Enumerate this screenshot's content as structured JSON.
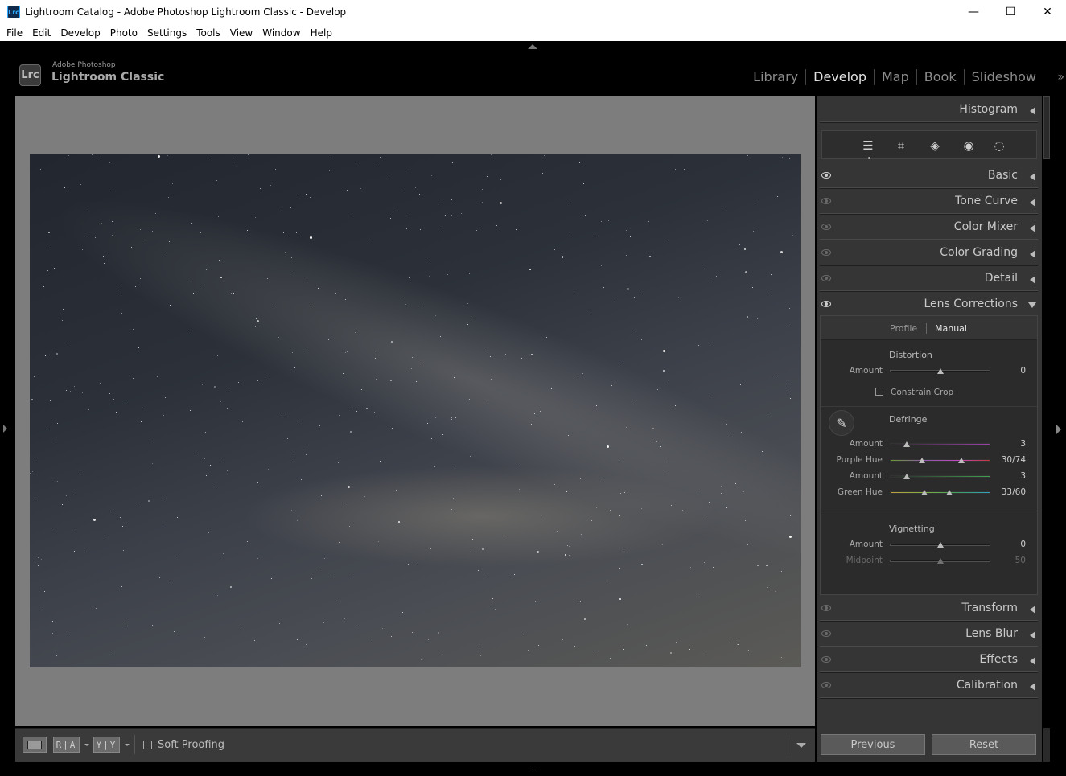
{
  "window": {
    "app_icon": "Lrc",
    "title": "Lightroom Catalog - Adobe Photoshop Lightroom Classic - Develop",
    "controls": {
      "minimize": "—",
      "maximize": "☐",
      "close": "✕"
    }
  },
  "menubar": {
    "items": [
      "File",
      "Edit",
      "Develop",
      "Photo",
      "Settings",
      "Tools",
      "View",
      "Window",
      "Help"
    ]
  },
  "brand": {
    "logo": "Lrc",
    "small": "Adobe Photoshop",
    "big": "Lightroom Classic"
  },
  "modules": {
    "items": [
      "Library",
      "Develop",
      "Map",
      "Book",
      "Slideshow"
    ],
    "active": "Develop",
    "more": "»"
  },
  "toolbar": {
    "before_after_left": "R|A",
    "before_after_right": "Y|Y",
    "soft_proofing_label": "Soft Proofing",
    "soft_proofing_checked": false
  },
  "right_panel": {
    "histogram": "Histogram",
    "tools": [
      "sliders-icon",
      "crop-icon",
      "eraser-icon",
      "redeye-icon",
      "mask-icon"
    ],
    "panels": {
      "basic": "Basic",
      "tone_curve": "Tone Curve",
      "color_mixer": "Color Mixer",
      "color_grading": "Color Grading",
      "detail": "Detail",
      "lens_corrections": "Lens Corrections",
      "transform": "Transform",
      "lens_blur": "Lens Blur",
      "effects": "Effects",
      "calibration": "Calibration"
    },
    "lens": {
      "tab_profile": "Profile",
      "tab_manual": "Manual",
      "active_tab": "Manual",
      "distortion": {
        "title": "Distortion",
        "amount_label": "Amount",
        "amount_value": "0",
        "amount_pos": 0.5,
        "constrain_crop_label": "Constrain Crop",
        "constrain_crop_checked": false
      },
      "defringe": {
        "title": "Defringe",
        "purple_amount_label": "Amount",
        "purple_amount_value": "3",
        "purple_amount_pos": 0.17,
        "purple_hue_label": "Purple Hue",
        "purple_hue_value": "30/74",
        "purple_hue_pos": [
          0.32,
          0.71
        ],
        "green_amount_label": "Amount",
        "green_amount_value": "3",
        "green_amount_pos": 0.17,
        "green_hue_label": "Green Hue",
        "green_hue_value": "33/60",
        "green_hue_pos": [
          0.34,
          0.59
        ]
      },
      "vignetting": {
        "title": "Vignetting",
        "amount_label": "Amount",
        "amount_value": "0",
        "amount_pos": 0.5,
        "midpoint_label": "Midpoint",
        "midpoint_value": "50",
        "midpoint_pos": 0.5
      }
    },
    "buttons": {
      "previous": "Previous",
      "reset": "Reset"
    }
  }
}
